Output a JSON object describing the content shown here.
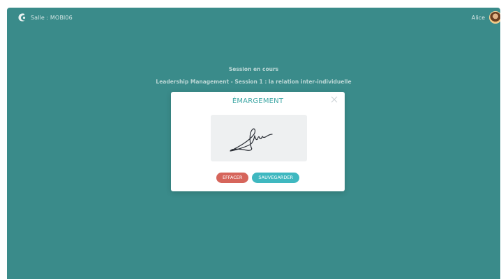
{
  "header": {
    "room_label": "Salle : MOBI06",
    "username": "Alice",
    "logo_icon": "app-logo-icon",
    "avatar_icon": "user-avatar"
  },
  "session": {
    "status": "Session en cours",
    "title": "Leadership Management - Session 1 : la relation inter-individuelle"
  },
  "modal": {
    "title": "ÉMARGEMENT",
    "close_icon": "close-icon",
    "signature_pad": "signature-canvas",
    "buttons": {
      "erase": "EFFACER",
      "save": "SAUVEGARDER"
    }
  },
  "colors": {
    "background": "#3a8b8a",
    "modal_title": "#3fa7a5",
    "erase_button": "#d6655b",
    "save_button": "#3fb8c0"
  }
}
